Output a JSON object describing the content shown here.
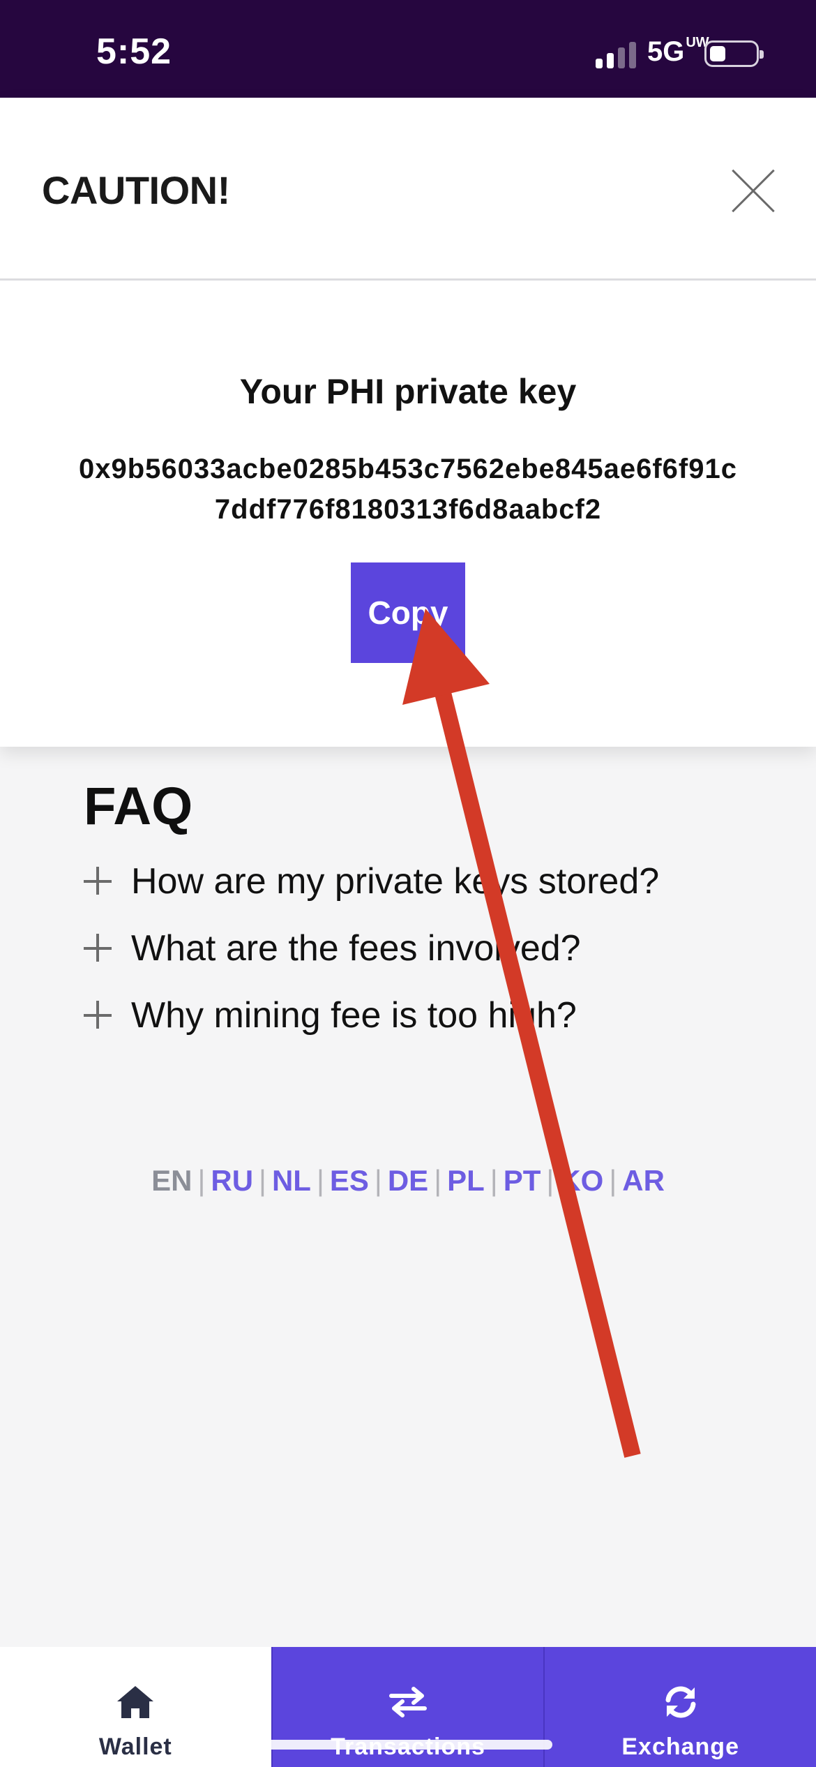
{
  "status_bar": {
    "time": "5:52",
    "network": "5G",
    "network_sub": "UW"
  },
  "modal": {
    "title": "CAUTION!",
    "heading": "Your PHI private key",
    "key_line_1": "0x9b56033acbe0285b453c7562ebe845ae6f6f91c",
    "key_line_2": "7ddf776f8180313f6d8aabcf2",
    "copy_label": "Copy"
  },
  "faq": {
    "title": "FAQ",
    "items": [
      {
        "label": "How are my private keys stored?"
      },
      {
        "label": "What are the fees involved?"
      },
      {
        "label": "Why mining fee is too high?"
      }
    ]
  },
  "languages": [
    "EN",
    "RU",
    "NL",
    "ES",
    "DE",
    "PL",
    "PT",
    "KO",
    "AR"
  ],
  "active_language": "EN",
  "tabs": [
    {
      "label": "Wallet",
      "icon": "home-icon"
    },
    {
      "label": "Transactions",
      "icon": "transfer-arrows-icon"
    },
    {
      "label": "Exchange",
      "icon": "refresh-icon"
    }
  ],
  "colors": {
    "accent": "#5b45dd",
    "status_bar": "#26063f",
    "annotation_arrow": "#d33a27"
  }
}
